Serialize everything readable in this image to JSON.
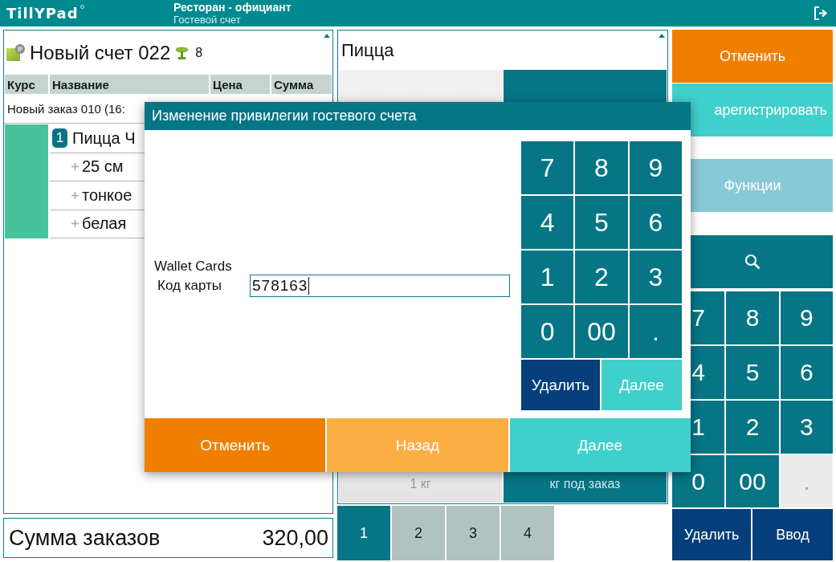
{
  "header": {
    "logo": "TillYPad",
    "title": "Ресторан - официант",
    "subtitle": "Гостевой счет"
  },
  "bill": {
    "title": "Новый счет 022",
    "guests": "8",
    "columns": [
      "Курс",
      "Название",
      "Цена",
      "Сумма"
    ],
    "order": "Новый заказ 010 (16:",
    "items": [
      {
        "kind": "dish",
        "number": "1",
        "name": "Пицца Ч"
      },
      {
        "kind": "modifier",
        "name": "25 см"
      },
      {
        "kind": "modifier",
        "name": "тонкое"
      },
      {
        "kind": "modifier",
        "name": "белая"
      }
    ]
  },
  "total": {
    "label": "Сумма заказов",
    "value": "320,00"
  },
  "menu": {
    "title": "Пицца",
    "tiles": [
      {
        "kind": "light"
      },
      {
        "kind": "dark"
      },
      {
        "kind": "light",
        "label": "1 кг"
      },
      {
        "kind": "dark",
        "label": "кг под заказ"
      }
    ],
    "pages": [
      {
        "label": "1",
        "selected": true
      },
      {
        "label": "2",
        "selected": false
      },
      {
        "label": "3",
        "selected": false
      },
      {
        "label": "4",
        "selected": false
      }
    ]
  },
  "actions": [
    {
      "kind": "cancel",
      "label": "Отменить"
    },
    {
      "kind": "register",
      "label": "арегистрировать"
    },
    {
      "kind": "functions",
      "label": "Функции"
    },
    {
      "kind": "search"
    }
  ],
  "keypad": {
    "keys": [
      {
        "label": "7",
        "disabled": false
      },
      {
        "label": "8",
        "disabled": false
      },
      {
        "label": "9",
        "disabled": false
      },
      {
        "label": "4",
        "disabled": false
      },
      {
        "label": "5",
        "disabled": false
      },
      {
        "label": "6",
        "disabled": false
      },
      {
        "label": "1",
        "disabled": false
      },
      {
        "label": "2",
        "disabled": false
      },
      {
        "label": "3",
        "disabled": false
      },
      {
        "label": "0",
        "disabled": false
      },
      {
        "label": "00",
        "disabled": false
      },
      {
        "label": ".",
        "disabled": true
      }
    ],
    "buttons": [
      "Удалить",
      "Ввод"
    ]
  },
  "dialog": {
    "title": "Изменение привилегии гостевого счета",
    "program": "Wallet Cards",
    "field_label": "Код карты",
    "field_value": "578163",
    "keys": [
      "7",
      "8",
      "9",
      "4",
      "5",
      "6",
      "1",
      "2",
      "3",
      "0",
      "00",
      "."
    ],
    "key_buttons": [
      {
        "kind": "delete",
        "label": "Удалить"
      },
      {
        "kind": "next",
        "label": "Далее"
      }
    ],
    "buttons": [
      {
        "kind": "cancel",
        "label": "Отменить"
      },
      {
        "kind": "back",
        "label": "Назад"
      },
      {
        "kind": "next",
        "label": "Далее"
      }
    ]
  }
}
